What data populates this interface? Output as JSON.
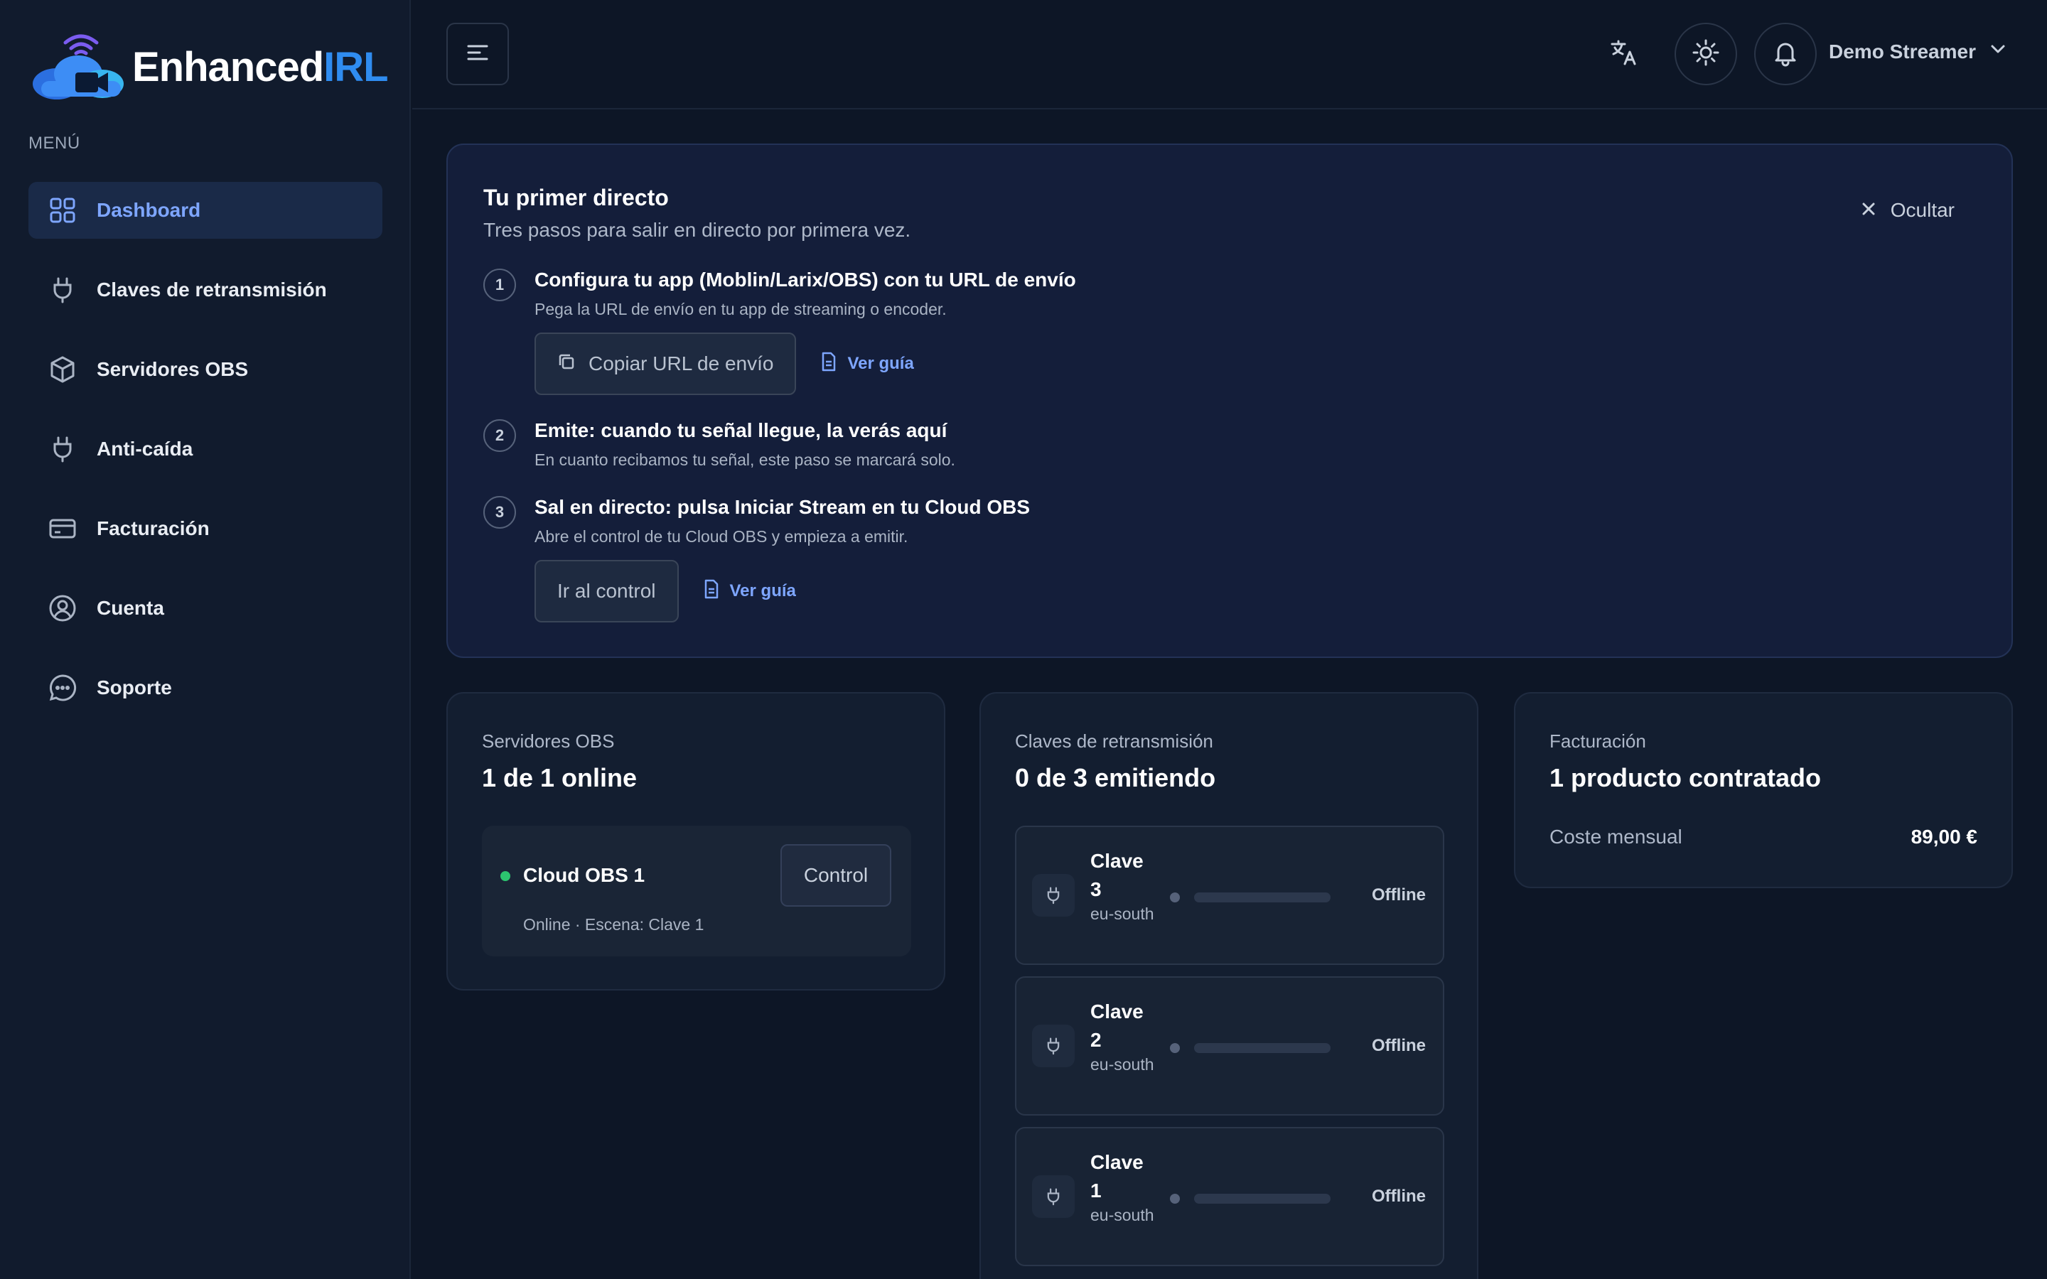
{
  "brand": {
    "name_part1": "Enhanced",
    "name_part2": "IRL"
  },
  "sidebar": {
    "menu_title": "MENÚ",
    "items": [
      {
        "label": "Dashboard",
        "icon": "grid-icon",
        "active": true
      },
      {
        "label": "Claves de retransmisión",
        "icon": "plug-icon"
      },
      {
        "label": "Servidores OBS",
        "icon": "cube-icon"
      },
      {
        "label": "Anti-caída",
        "icon": "plug-icon"
      },
      {
        "label": "Facturación",
        "icon": "credit-card-icon"
      },
      {
        "label": "Cuenta",
        "icon": "user-circle-icon"
      },
      {
        "label": "Soporte",
        "icon": "chat-icon"
      }
    ]
  },
  "header": {
    "user_name": "Demo Streamer"
  },
  "onboarding": {
    "title": "Tu primer directo",
    "subtitle": "Tres pasos para salir en directo por primera vez.",
    "hide_label": "Ocultar",
    "steps": [
      {
        "num": "1",
        "title": "Configura tu app (Moblin/Larix/OBS) con tu URL de envío",
        "desc": "Pega la URL de envío en tu app de streaming o encoder.",
        "button": "Copiar URL de envío",
        "guide": "Ver guía"
      },
      {
        "num": "2",
        "title": "Emite: cuando tu señal llegue, la verás aquí",
        "desc": "En cuanto recibamos tu señal, este paso se marcará solo."
      },
      {
        "num": "3",
        "title": "Sal en directo: pulsa Iniciar Stream en tu Cloud OBS",
        "desc": "Abre el control de tu Cloud OBS y empieza a emitir.",
        "button": "Ir al control",
        "guide": "Ver guía"
      }
    ]
  },
  "servers_card": {
    "label": "Servidores OBS",
    "value": "1 de 1 online",
    "server": {
      "name": "Cloud OBS 1",
      "meta": "Online · Escena: Clave 1",
      "control_label": "Control",
      "status_color": "#2cc56f"
    }
  },
  "keys_card": {
    "label": "Claves de retransmisión",
    "value": "0 de 3 emitiendo",
    "keys": [
      {
        "name": "Clave 3",
        "region": "eu-south",
        "status": "Offline"
      },
      {
        "name": "Clave 2",
        "region": "eu-south",
        "status": "Offline"
      },
      {
        "name": "Clave 1",
        "region": "eu-south",
        "status": "Offline"
      }
    ]
  },
  "billing_card": {
    "label": "Facturación",
    "value": "1 producto contratado",
    "row_label": "Coste mensual",
    "row_value": "89,00 €"
  },
  "colors": {
    "accent": "#7ea6ff",
    "brand_blue": "#2f8cf0",
    "online": "#2cc56f"
  }
}
